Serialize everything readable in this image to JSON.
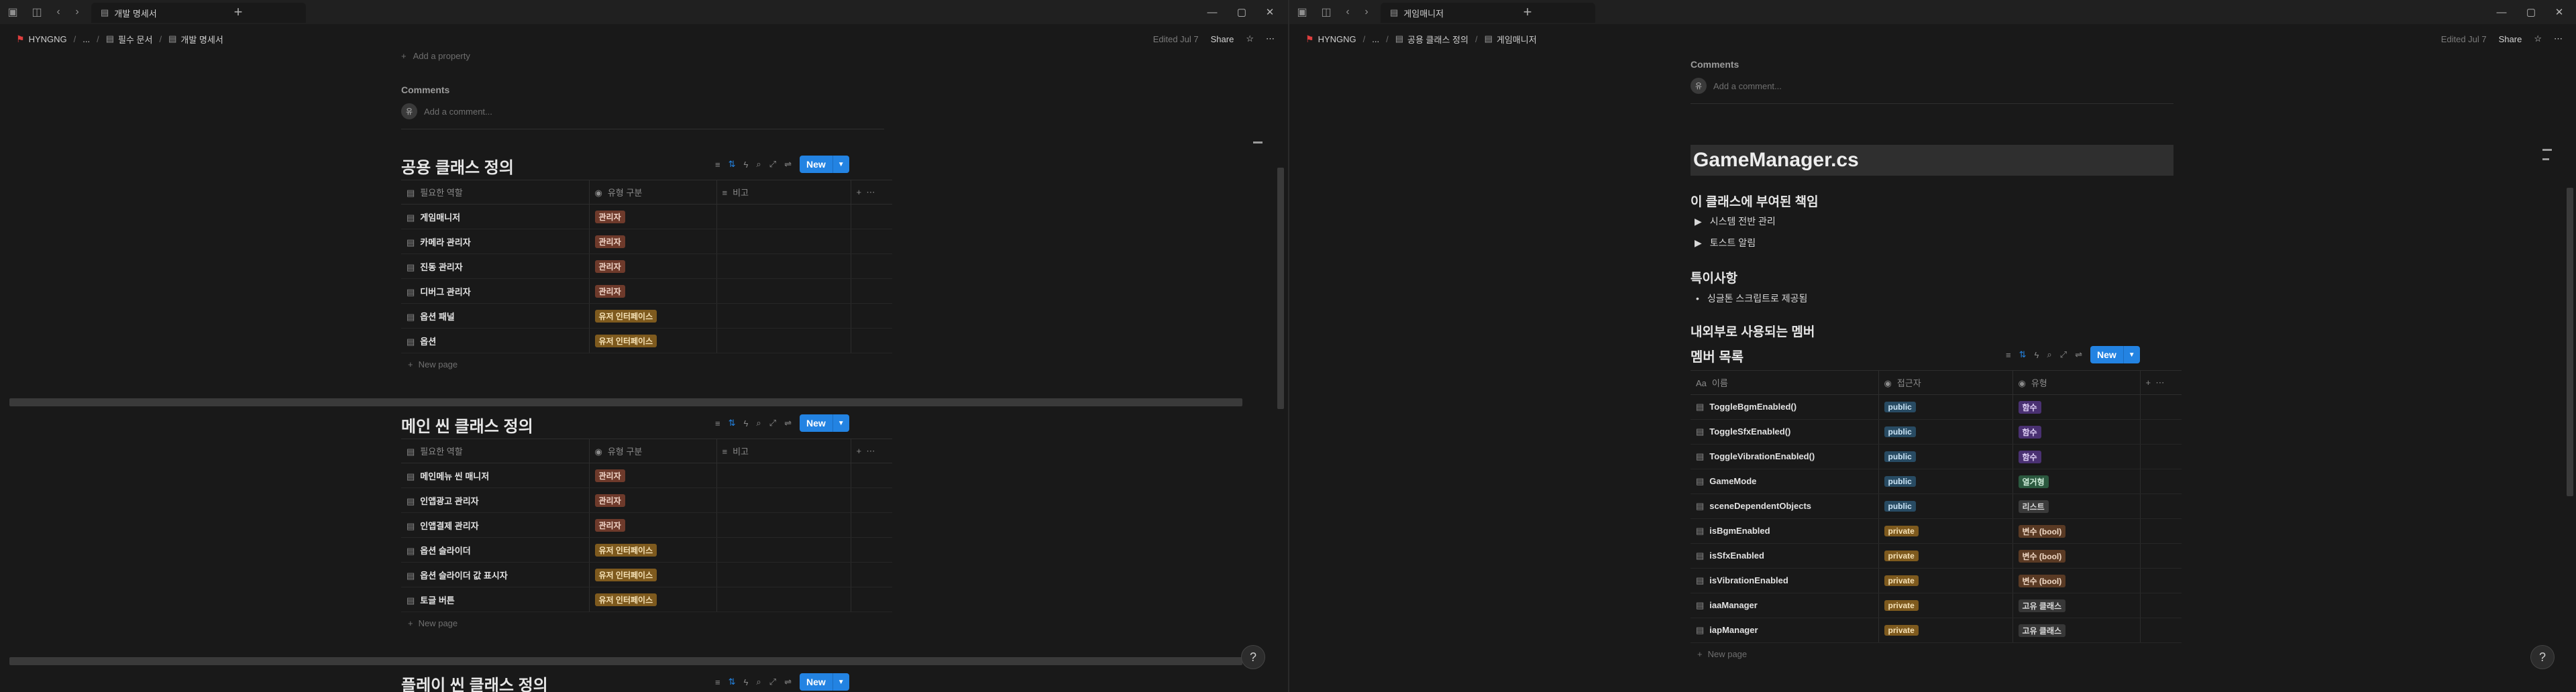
{
  "left": {
    "tab_title": "개발 명세서",
    "breadcrumb": [
      "HYNGNG",
      "...",
      "필수 문서",
      "개발 명세서"
    ],
    "edited": "Edited Jul 7",
    "share": "Share",
    "add_property": "Add a property",
    "comments": "Comments",
    "add_comment": "Add a comment...",
    "db1": {
      "title": "공용 클래스 정의",
      "new": "New",
      "cols": [
        "필요한 역할",
        "유형 구분",
        "비고"
      ],
      "rows": [
        [
          "게임매니저",
          "관리자"
        ],
        [
          "카메라 관리자",
          "관리자"
        ],
        [
          "진동 관리자",
          "관리자"
        ],
        [
          "디버그 관리자",
          "관리자"
        ],
        [
          "옵션 패널",
          "유저 인터페이스"
        ],
        [
          "옵션",
          "유저 인터페이스"
        ]
      ],
      "new_page": "New page"
    },
    "db2": {
      "title": "메인 씬 클래스 정의",
      "new": "New",
      "cols": [
        "필요한 역할",
        "유형 구분",
        "비고"
      ],
      "rows": [
        [
          "메인메뉴 씬 매니저",
          "관리자"
        ],
        [
          "인앱광고 관리자",
          "관리자"
        ],
        [
          "인앱결제 관리자",
          "관리자"
        ],
        [
          "옵션 슬라이더",
          "유저 인터페이스"
        ],
        [
          "옵션 슬라이더 값 표시자",
          "유저 인터페이스"
        ],
        [
          "토글 버튼",
          "유저 인터페이스"
        ]
      ],
      "new_page": "New page"
    },
    "db3": {
      "title": "플레이 씬 클래스 정의",
      "new": "New"
    }
  },
  "right": {
    "tab_title": "게임매니저",
    "breadcrumb": [
      "HYNGNG",
      "...",
      "공용 클래스 정의",
      "게임매니저"
    ],
    "edited": "Edited Jul 7",
    "share": "Share",
    "comments": "Comments",
    "add_comment": "Add a comment...",
    "page_title": "GameManager.cs",
    "h_resp": "이 클래스에 부여된 책임",
    "toggles": [
      "시스템 전반 관리",
      "토스트 알림"
    ],
    "h_notes": "특이사항",
    "bullets": [
      "싱글톤 스크립트로 제공됨"
    ],
    "h_members": "내외부로 사용되는 멤버",
    "db": {
      "title": "멤버 목록",
      "new": "New",
      "cols": [
        "이름",
        "접근자",
        "유형"
      ],
      "rows": [
        [
          "ToggleBgmEnabled()",
          "public",
          "함수"
        ],
        [
          "ToggleSfxEnabled()",
          "public",
          "함수"
        ],
        [
          "ToggleVibrationEnabled()",
          "public",
          "함수"
        ],
        [
          "GameMode",
          "public",
          "열거형"
        ],
        [
          "sceneDependentObjects",
          "public",
          "리스트"
        ],
        [
          "isBgmEnabled",
          "private",
          "변수 (bool)"
        ],
        [
          "isSfxEnabled",
          "private",
          "변수 (bool)"
        ],
        [
          "isVibrationEnabled",
          "private",
          "변수 (bool)"
        ],
        [
          "iaaManager",
          "private",
          "고유 클래스"
        ],
        [
          "iapManager",
          "private",
          "고유 클래스"
        ]
      ],
      "new_page": "New page"
    }
  }
}
